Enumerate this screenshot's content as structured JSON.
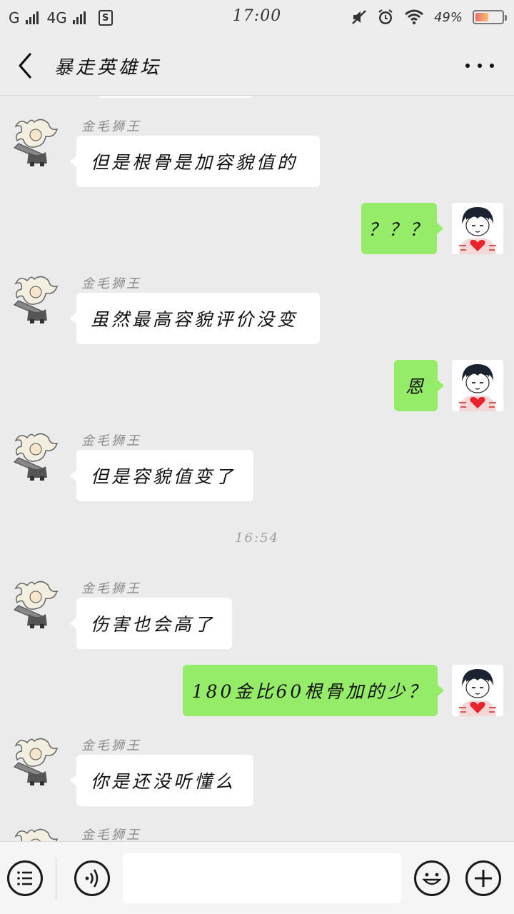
{
  "status_bar": {
    "carrier1": "G",
    "carrier2": "4G",
    "sim_icon": "S",
    "time": "17:00",
    "battery": "49%",
    "icons": [
      "signal-bars-icon",
      "sim-card-icon",
      "mute-icon",
      "alarm-icon",
      "wifi-icon",
      "battery-icon"
    ]
  },
  "header": {
    "title": "暴走英雄坛",
    "back_icon": "chevron-left-icon",
    "more_icon": "more-dots-icon"
  },
  "messages": [
    {
      "side": "in",
      "sender": "金毛狮王",
      "text": "但是根骨是加容貌值的"
    },
    {
      "side": "out",
      "text": "？？？"
    },
    {
      "side": "in",
      "sender": "金毛狮王",
      "text": "虽然最高容貌评价没变"
    },
    {
      "side": "out",
      "text": "恩"
    },
    {
      "side": "in",
      "sender": "金毛狮王",
      "text": "但是容貌值变了"
    },
    {
      "side": "in",
      "sender": "金毛狮王",
      "text": "伤害也会高了"
    },
    {
      "side": "out",
      "text": "180金比60根骨加的少？"
    },
    {
      "side": "in",
      "sender": "金毛狮王",
      "text": "你是还没听懂么"
    },
    {
      "side": "in",
      "sender": "金毛狮王",
      "text": ""
    }
  ],
  "time_separator": "16:54",
  "input_bar": {
    "menu_icon": "menu-list-icon",
    "voice_icon": "voice-icon",
    "input_value": "",
    "emoji_icon": "emoji-icon",
    "add_icon": "plus-icon"
  },
  "colors": {
    "background": "#ebebeb",
    "incoming_bubble": "#ffffff",
    "outgoing_bubble": "#95ec69",
    "header": "#ededed"
  }
}
